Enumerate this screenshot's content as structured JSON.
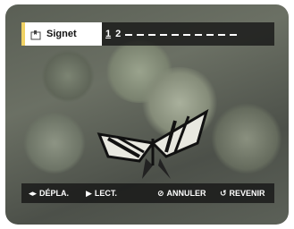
{
  "topbar": {
    "title": "Signet",
    "mark1": "1",
    "mark2": "2"
  },
  "bottombar": {
    "move_label": "DÉPLA.",
    "play_label": "LECT.",
    "cancel_label": "ANNULER",
    "return_label": "REVENIR"
  },
  "icons": {
    "bookmark": "bookmark-icon",
    "move": "left-right-arrows-icon",
    "play": "play-icon",
    "cancel": "cancel-icon",
    "return": "return-icon"
  }
}
